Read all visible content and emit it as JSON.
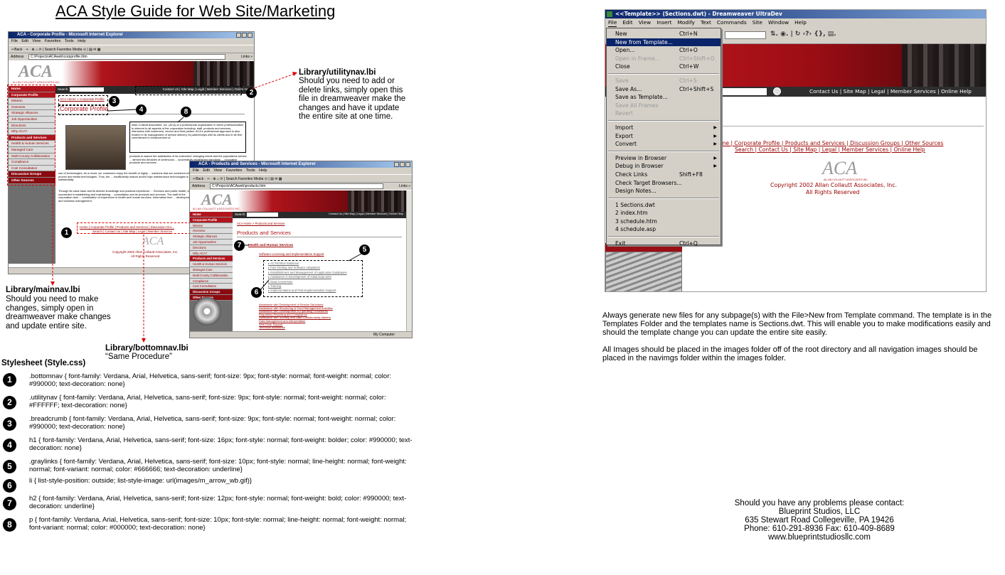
{
  "title": "ACA Style Guide for Web Site/Marketing",
  "ie_window_1": {
    "title": "ACA - Corporate Profile - Microsoft Internet Explorer",
    "menu": "File  Edit  View  Favorites  Tools  Help",
    "toolbar": "⇐Back · ⇒ · ⊗ ⌂ ⟳ | Search  Favorites  Media  ⊙ | ▤ ✉ ▦",
    "address_label": "Address",
    "address": "C:\\Projects\\ACAweb\\corpprofile.htm",
    "go": "Go",
    "links": "Links »",
    "logo": "ACA",
    "tagline": "ALLAN COLLAUTT ASSOCIATES INC.",
    "search_label": "Search:",
    "util_links": "Contact Us | Site Map | Legal | Member Services | Online Help",
    "breadcrumb": "ACA Home > Corporate Profile",
    "h1": "Corporate Profile",
    "para1": "Allan Collautt Associates, Inc. (ACA) is a professional organization in which professionalism is inherent to all aspects of the corporation including: staff, products and services; interaction with customers, vendor and third parties. ACA's professional approach is also evident in its management of service delivery, its partnerships with its clients and in its firm commitment to enhancement of",
    "para2": "products to assure the satisfaction of its customers' changing needs and the populations served. ... almost two decades of continuous ... successfully established standards ... innovative products and services",
    "para3": "use of technologies. As a result, our customers enjoy the benefit of highly ... solutions that are combined with proven and tested technologies. Thus, the ... insufficiently mature and/or high maintenance technologies is substantially",
    "para4": "Through its value base and its diverse knowledge and practical experience ... Services and public health, ACA succeeded in establishing and maintaining ... consultation and its products and services. The staff of the corporation dem ... combination of experience in health and human services, information tech ... development, and business management.",
    "bottom_links1": "Home | Corporate Profile | Products and Services | Discussion Gro...",
    "bottom_links2": "Search | Contact Us | Site Map | Legal | Member Services",
    "copyright": "Copyright 2002 Allan Collautt Associates, Inc.",
    "rights": "All Rights Reserved",
    "nav": [
      "Home",
      "Corporate Profile",
      "Mission",
      "Overview",
      "Strategic Alliances",
      "Job Opportunities",
      "Directions",
      "Why ACA?",
      "Products and Services",
      "Health & Human Services",
      "Managed Care",
      "Multi-County Collaboration",
      "Compliance",
      "Cost Consultation",
      "Discussion Groups",
      "Other Sources"
    ]
  },
  "ie_window_2": {
    "title": "ACA - Products and Services - Microsoft Internet Explorer",
    "menu": "File  Edit  View  Favorites  Tools  Help",
    "toolbar": "⇐Back · ⇒ · ⊗ ⌂ ⟳ | Search  Favorites  Media  ⊙ | ▤ ✉ ▦",
    "address_label": "Address",
    "address": "C:\\Projects\\ACAweb\\products.htm",
    "go": "Go",
    "links": "Links »",
    "logo": "ACA",
    "tagline": "ALLAN COLLAUTT ASSOCIATES INC.",
    "search_label": "Search:",
    "util_links": "Contact Us | Site Map | Legal | Member Services | Online Help",
    "breadcrumb": "ACA Home > Products and Services",
    "h1": "Products and Services",
    "h2": "Health and Human Services",
    "sub_link": "Software Licensing and Implementation Support",
    "list": [
      "ACTS/Altus Solutions",
      "Fact Finding and Software Adaptation",
      "Establishment and Management of Application Databases",
      "Assistance in Development of Initial Data Sets",
      "Data Conversion",
      "Training",
      "Implementation and Post-Implementation Support"
    ],
    "links_more": [
      "Assistance with Development of Service Structures",
      "Assistance with Structuring of Fund Management Activities",
      "Assistance with Development of Operating Procedures",
      "Regulatory Reporting and Compliance",
      "Assistance with Security and Data Confidentiality Matters",
      "Data Management and Interpretation",
      "Web Desk Support",
      "Technical Assistance"
    ],
    "status": "My Computer",
    "nav": [
      "Home",
      "Corporate Profile",
      "Mission",
      "Overview",
      "Strategic Alliances",
      "Job Opportunities",
      "Directions",
      "Why ACA?",
      "Products and Services",
      "Health & Human Services",
      "Managed Care",
      "Multi-County Collaboration",
      "Compliance",
      "Cost Consultation",
      "Discussion Groups",
      "Other Sources"
    ]
  },
  "callouts": {
    "utilitynav_title": "Library/utilitynav.lbi",
    "utilitynav_body": [
      "Should you need to add or",
      "delete links, simply open this",
      "file in dreamweaver make the",
      "changes and have it update",
      "the entire site at one time."
    ],
    "mainnav_title": "Library/mainnav.lbi",
    "mainnav_body": [
      "Should you need to make",
      "changes, simply open in",
      "dreamweaver make changes",
      "and update entire site."
    ],
    "bottomnav_title": "Library/bottomnav.lbi",
    "bottomnav_body": "“Same Procedure”"
  },
  "stylesheet": {
    "heading": "Stylesheet (Style.css)",
    "rules": [
      {
        "num": "1",
        "text": ".bottomnav {  font-family: Verdana, Arial, Helvetica, sans-serif; font-size: 9px; font-style: normal; font-weight: normal; color: #990000; text-decoration: none}"
      },
      {
        "num": "2",
        "text": ".utilitynav {  font-family: Verdana, Arial, Helvetica, sans-serif; font-size: 9px; font-style: normal; font-weight: normal; color: #FFFFFF; text-decoration: none}"
      },
      {
        "num": "3",
        "text": ".breadcrumb {  font-family: Verdana, Arial, Helvetica, sans-serif; font-size: 9px; font-style: normal; font-weight: normal; color: #990000; text-decoration: none}"
      },
      {
        "num": "4",
        "text": "h1 {  font-family: Verdana, Arial, Helvetica, sans-serif; font-size: 16px; font-style: normal; font-weight: bolder; color: #990000; text-decoration: none}"
      },
      {
        "num": "5",
        "text": ".graylinks {  font-family: Verdana, Arial, Helvetica, sans-serif; font-size: 10px; font-style: normal; line-height: normal; font-weight: normal; font-variant: normal; color: #666666; text-decoration: underline}"
      },
      {
        "num": "6",
        "text": "li {  list-style-position: outside; list-style-image: url(images/m_arrow_wb.gif)}"
      },
      {
        "num": "7",
        "text": "h2 {  font-family: Verdana, Arial, Helvetica, sans-serif; font-size: 12px; font-style: normal; font-weight: bold; color: #990000; text-decoration: underline}"
      },
      {
        "num": "8",
        "text": "p {  font-family: Verdana, Arial, Helvetica, sans-serif; font-size: 10px; font-style: normal; line-height: normal; font-weight: normal; font-variant: normal; color: #000000; text-decoration: none}"
      }
    ]
  },
  "dreamweaver": {
    "title": "<<Template>> (Sections.dwt) - Dreamweaver UltraDev",
    "menubar": [
      "File",
      "Edit",
      "View",
      "Insert",
      "Modify",
      "Text",
      "Commands",
      "Site",
      "Window",
      "Help"
    ],
    "file_menu": [
      {
        "label": "New",
        "shortcut": "Ctrl+N"
      },
      {
        "label": "New from Template...",
        "selected": true
      },
      {
        "label": "Open...",
        "shortcut": "Ctrl+O"
      },
      {
        "label": "Open in Frame...",
        "shortcut": "Ctrl+Shift+O",
        "disabled": true
      },
      {
        "label": "Close",
        "shortcut": "Ctrl+W"
      },
      {
        "sep": true
      },
      {
        "label": "Save",
        "shortcut": "Ctrl+S",
        "disabled": true
      },
      {
        "label": "Save As...",
        "shortcut": "Ctrl+Shift+S"
      },
      {
        "label": "Save as Template..."
      },
      {
        "label": "Save All Frames",
        "disabled": true
      },
      {
        "label": "Revert",
        "disabled": true
      },
      {
        "sep": true
      },
      {
        "label": "Import",
        "sub": true
      },
      {
        "label": "Export",
        "sub": true
      },
      {
        "label": "Convert",
        "sub": true
      },
      {
        "sep": true
      },
      {
        "label": "Preview in Browser",
        "sub": true
      },
      {
        "label": "Debug in Browser",
        "sub": true
      },
      {
        "label": "Check Links",
        "shortcut": "Shift+F8"
      },
      {
        "label": "Check Target Browsers..."
      },
      {
        "label": "Design Notes..."
      },
      {
        "sep": true
      },
      {
        "label": "1 Sections.dwt"
      },
      {
        "label": "2 index.htm"
      },
      {
        "label": "3 schedule.htm"
      },
      {
        "label": "4 schedule.asp"
      },
      {
        "sep": true
      },
      {
        "label": "Exit",
        "shortcut": "Ctrl+Q"
      }
    ],
    "util_links": "Contact Us | Site Map | Legal | Member Services | Online Help",
    "bottom_links1": "me | Corporate Profile | Products and Services | Discussion Groups | Other Sources",
    "bottom_links2": "Search | Contact Us | Site Map | Legal | Member Services | Online Help",
    "logo": "ACA",
    "tagline": "ALLAN COLLAUTT ASSOCIATES INC.",
    "copyright": "Copyright 2002 Allan Collautt Associates, Inc.",
    "rights": "All Rights Reserved"
  },
  "notes": {
    "template_note": "Always generate new files for any subpage(s) with the File>New from Template command. The template is in the Templates Folder and the templates name is Sections.dwt. This will enable you to make modifications easily and should the template change you can update the entire site easily.",
    "images_note": "All Images should be placed in the images folder off of the root directory and all navigation images should be placed in the navimgs folder within the images folder."
  },
  "contact": {
    "line1": "Should you have any problems please contact:",
    "line2": "Blueprint Studios, LLC",
    "line3": "635 Stewart Road Collegeville, PA 19426",
    "line4": "Phone: 610-291-8936  Fax: 610-409-8689",
    "line5": "www.blueprintstudiosllc.com"
  },
  "colors": {
    "brand_red": "#b0141c",
    "dark_red": "#990000",
    "menu_highlight": "#0a246a"
  }
}
